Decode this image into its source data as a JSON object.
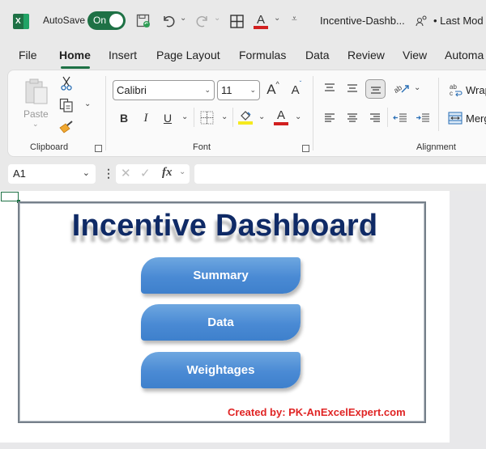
{
  "titlebar": {
    "app_icon": "excel-logo-icon",
    "autosave_label": "AutoSave",
    "autosave_state": "On",
    "icons": [
      "save-sync-icon",
      "undo-icon",
      "redo-icon",
      "borders-icon",
      "font-color-icon",
      "customize-qat-icon",
      "coauthor-icon"
    ],
    "document_title": "Incentive-Dashb...",
    "last_modified": "• Last Mod"
  },
  "menu": {
    "tabs": [
      "File",
      "Home",
      "Insert",
      "Page Layout",
      "Formulas",
      "Data",
      "Review",
      "View",
      "Automa"
    ],
    "active_tab": "Home"
  },
  "ribbon": {
    "clipboard": {
      "label": "Clipboard",
      "paste_label": "Paste"
    },
    "font": {
      "label": "Font",
      "font_name": "Calibri",
      "font_size": "11",
      "bold": "B",
      "italic": "I",
      "underline": "U",
      "grow": "A",
      "shrink": "A",
      "font_color": "A",
      "highlight_color": "#f5ea1e",
      "font_color_value": "#d11f1f"
    },
    "alignment": {
      "label": "Alignment",
      "wrap_label": "Wrap",
      "merge_label": "Merg"
    }
  },
  "formula_bar": {
    "name_box": "A1",
    "fx_label": "fx",
    "formula_value": ""
  },
  "sheet": {
    "title": "Incentive Dashboard",
    "buttons": [
      "Summary",
      "Data",
      "Weightages"
    ],
    "credit": "Created by: PK-AnExcelExpert.com"
  },
  "colors": {
    "excel_green": "#1e7145",
    "title_navy": "#0f2a66",
    "button_blue": "#4a8ad4",
    "credit_red": "#e02424"
  }
}
